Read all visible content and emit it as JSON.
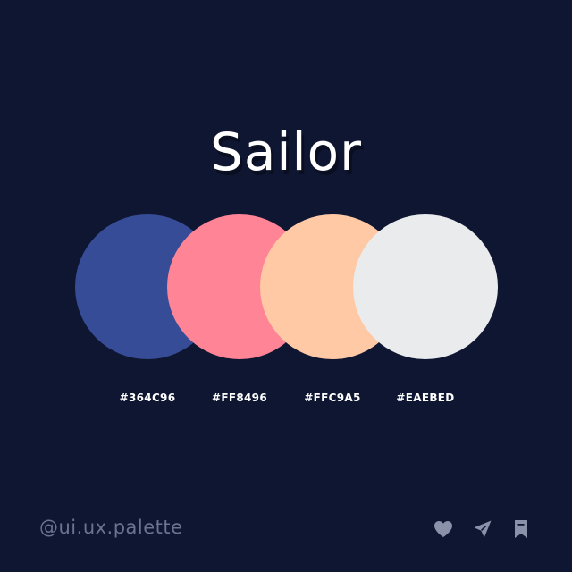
{
  "title": "Sailor",
  "palette": [
    {
      "hex_label": "#364C96",
      "color": "#364C96"
    },
    {
      "hex_label": "#FF8496",
      "color": "#FF8496"
    },
    {
      "hex_label": "#FFC9A5",
      "color": "#FFC9A5"
    },
    {
      "hex_label": "#EAEBED",
      "color": "#EAEBED"
    }
  ],
  "footer": {
    "handle": "@ui.ux.palette",
    "icons": [
      "heart-icon",
      "send-icon",
      "bookmark-icon"
    ],
    "icon_color": "#8a91a8"
  },
  "colors": {
    "background": "#0F1632",
    "text": "#FFFFFF"
  }
}
